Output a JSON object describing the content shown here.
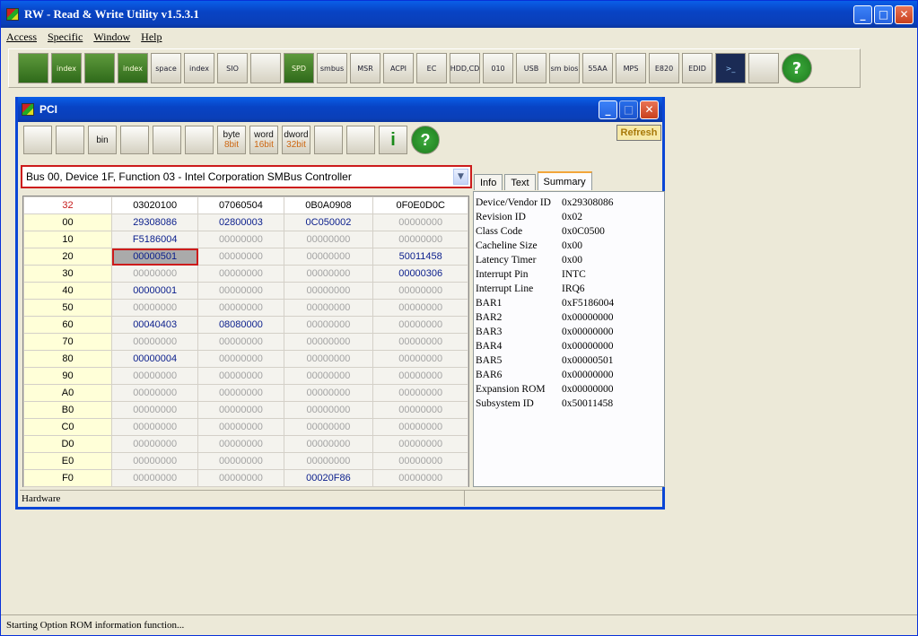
{
  "window": {
    "title": "RW - Read & Write Utility v1.5.3.1"
  },
  "menu": [
    "Access",
    "Specific",
    "Window",
    "Help"
  ],
  "toolbar": [
    {
      "name": "pci-icon",
      "label": ""
    },
    {
      "name": "index-icon",
      "label": "index"
    },
    {
      "name": "memory-icon",
      "label": ""
    },
    {
      "name": "index-memory-icon",
      "label": "index"
    },
    {
      "name": "io-space-icon",
      "label": "space"
    },
    {
      "name": "io-index-icon",
      "label": "index"
    },
    {
      "name": "sio-icon",
      "label": "SIO"
    },
    {
      "name": "waveform-icon",
      "label": ""
    },
    {
      "name": "spd-icon",
      "label": "SPD"
    },
    {
      "name": "smbus-icon",
      "label": "smbus"
    },
    {
      "name": "msr-icon",
      "label": "MSR"
    },
    {
      "name": "acpi-icon",
      "label": "ACPI"
    },
    {
      "name": "ec-icon",
      "label": "EC"
    },
    {
      "name": "hdd-cd-icon",
      "label": "HDD,CD"
    },
    {
      "name": "disk-010-icon",
      "label": "010"
    },
    {
      "name": "usb-icon",
      "label": "USB"
    },
    {
      "name": "smbios-icon",
      "label": "sm bios"
    },
    {
      "name": "55aa-icon",
      "label": "55AA"
    },
    {
      "name": "mps-icon",
      "label": "MPS"
    },
    {
      "name": "e820-icon",
      "label": "E820"
    },
    {
      "name": "edid-icon",
      "label": "EDID"
    },
    {
      "name": "command-icon",
      "label": ">_"
    },
    {
      "name": "config-icon",
      "label": ""
    },
    {
      "name": "help-icon",
      "label": "?"
    }
  ],
  "pci": {
    "title": "PCI",
    "refresh_label": "Refresh",
    "device": "Bus 00, Device 1F, Function 03 - Intel Corporation SMBus Controller",
    "toolbar": [
      {
        "name": "save-icon",
        "top": "",
        "bottom": ""
      },
      {
        "name": "save-all-icon",
        "top": "",
        "bottom": ""
      },
      {
        "name": "bin-icon",
        "top": "bin",
        "bottom": ""
      },
      {
        "name": "load-icon",
        "top": "",
        "bottom": ""
      },
      {
        "name": "find-icon",
        "top": "",
        "bottom": ""
      },
      {
        "name": "table-icon",
        "top": "",
        "bottom": ""
      },
      {
        "name": "byte-8bit-button",
        "top": "byte",
        "bottom": "8bit"
      },
      {
        "name": "word-16bit-button",
        "top": "word",
        "bottom": "16bit"
      },
      {
        "name": "dword-32bit-button",
        "top": "dword",
        "bottom": "32bit"
      },
      {
        "name": "tree-icon",
        "top": "",
        "bottom": ""
      },
      {
        "name": "gear-icon",
        "top": "",
        "bottom": ""
      },
      {
        "name": "info-icon",
        "top": "i",
        "bottom": ""
      },
      {
        "name": "help-icon",
        "top": "?",
        "bottom": ""
      }
    ],
    "grid": {
      "header": [
        "32",
        "03020100",
        "07060504",
        "0B0A0908",
        "0F0E0D0C"
      ],
      "rows": [
        [
          "00",
          "29308086",
          "02800003",
          "0C050002",
          "00000000"
        ],
        [
          "10",
          "F5186004",
          "00000000",
          "00000000",
          "00000000"
        ],
        [
          "20",
          "00000501",
          "00000000",
          "00000000",
          "50011458"
        ],
        [
          "30",
          "00000000",
          "00000000",
          "00000000",
          "00000306"
        ],
        [
          "40",
          "00000001",
          "00000000",
          "00000000",
          "00000000"
        ],
        [
          "50",
          "00000000",
          "00000000",
          "00000000",
          "00000000"
        ],
        [
          "60",
          "00040403",
          "08080000",
          "00000000",
          "00000000"
        ],
        [
          "70",
          "00000000",
          "00000000",
          "00000000",
          "00000000"
        ],
        [
          "80",
          "00000004",
          "00000000",
          "00000000",
          "00000000"
        ],
        [
          "90",
          "00000000",
          "00000000",
          "00000000",
          "00000000"
        ],
        [
          "A0",
          "00000000",
          "00000000",
          "00000000",
          "00000000"
        ],
        [
          "B0",
          "00000000",
          "00000000",
          "00000000",
          "00000000"
        ],
        [
          "C0",
          "00000000",
          "00000000",
          "00000000",
          "00000000"
        ],
        [
          "D0",
          "00000000",
          "00000000",
          "00000000",
          "00000000"
        ],
        [
          "E0",
          "00000000",
          "00000000",
          "00000000",
          "00000000"
        ],
        [
          "F0",
          "00000000",
          "00000000",
          "00020F86",
          "00000000"
        ]
      ],
      "selected": {
        "row": 2,
        "col": 1
      }
    },
    "tabs": [
      "Info",
      "Text",
      "Summary"
    ],
    "active_tab": "Summary",
    "summary": [
      {
        "k": "Device/Vendor ID",
        "v": "0x29308086"
      },
      {
        "k": "Revision ID",
        "v": "0x02"
      },
      {
        "k": "Class Code",
        "v": "0x0C0500"
      },
      {
        "k": "Cacheline Size",
        "v": "0x00"
      },
      {
        "k": "Latency Timer",
        "v": "0x00"
      },
      {
        "k": "Interrupt Pin",
        "v": "INTC"
      },
      {
        "k": "Interrupt Line",
        "v": "IRQ6"
      },
      {
        "k": "BAR1",
        "v": "0xF5186004"
      },
      {
        "k": "BAR2",
        "v": "0x00000000"
      },
      {
        "k": "BAR3",
        "v": "0x00000000"
      },
      {
        "k": "BAR4",
        "v": "0x00000000"
      },
      {
        "k": "BAR5",
        "v": "0x00000501"
      },
      {
        "k": "BAR6",
        "v": "0x00000000"
      },
      {
        "k": "Expansion ROM",
        "v": "0x00000000"
      },
      {
        "k": "Subsystem ID",
        "v": "0x50011458"
      }
    ],
    "status_left": "Hardware"
  },
  "statusbar": "Starting Option ROM information function..."
}
